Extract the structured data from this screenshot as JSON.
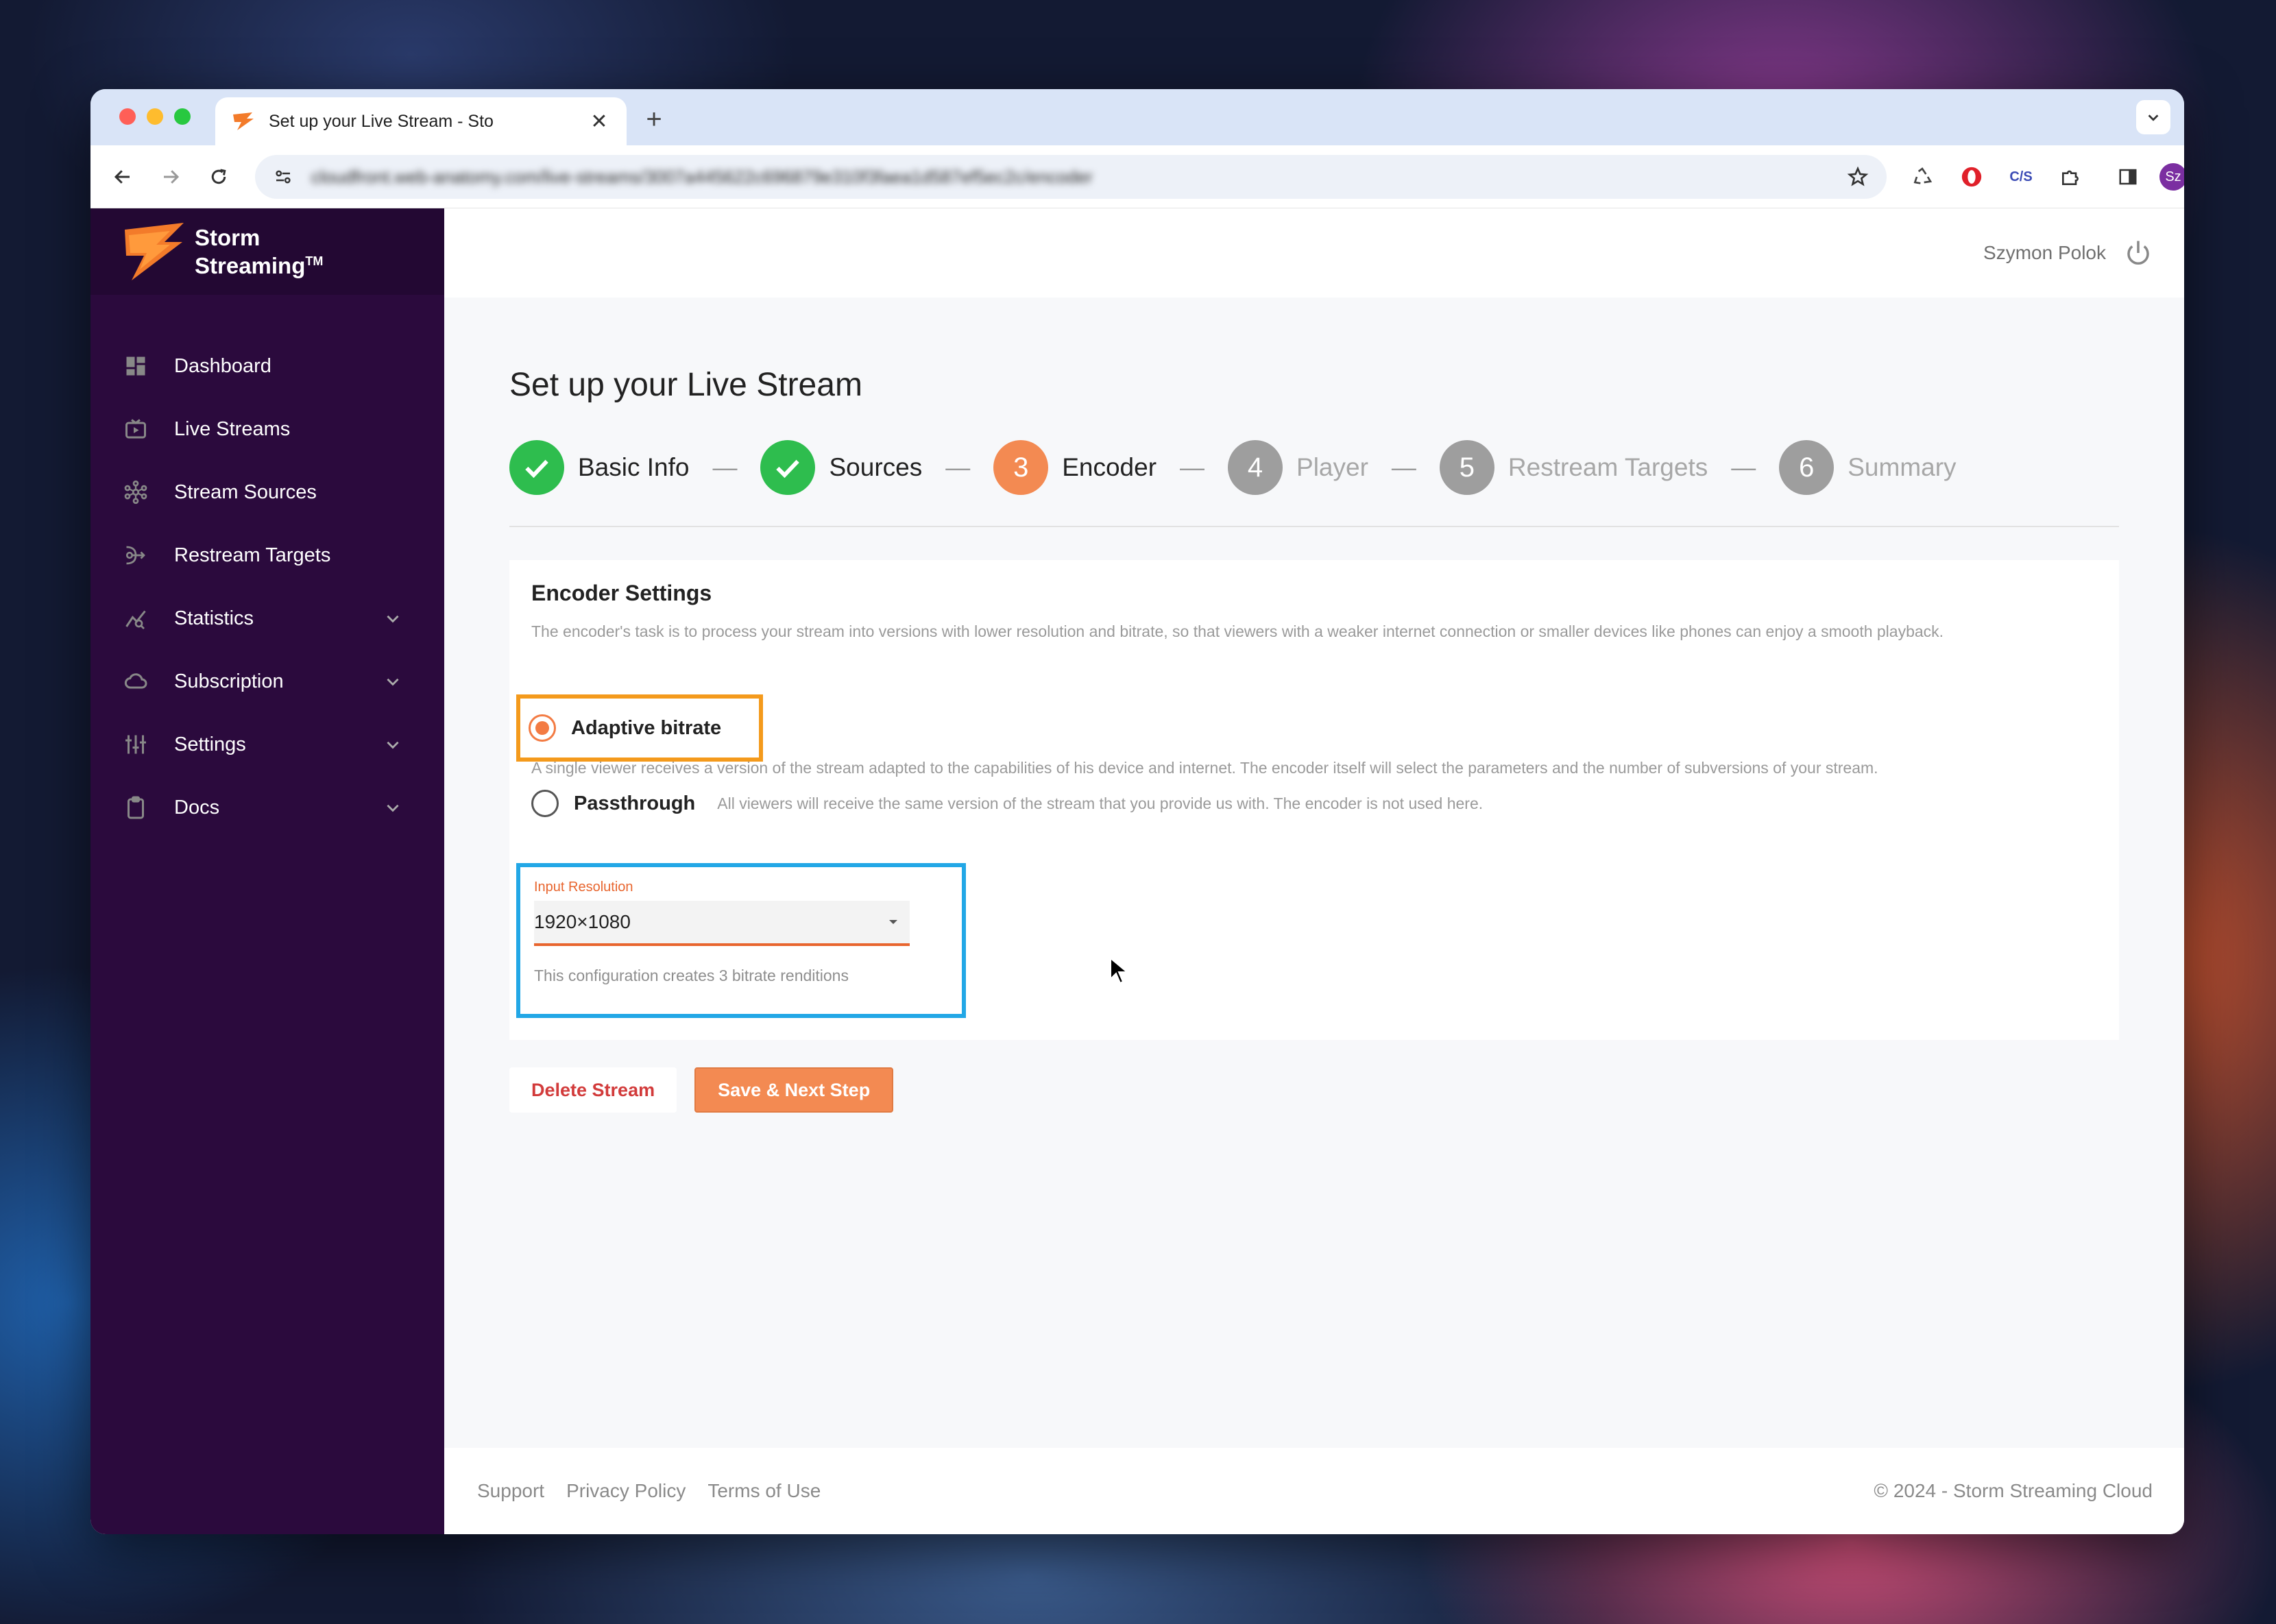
{
  "browser": {
    "tab_title": "Set up your Live Stream - Sto",
    "url": "cloudfront.web-anatomy.com/live-streams/3007a445622c696879e310f3faea1d587ef5ec2c/encoder",
    "new_tab": "+",
    "tab_close": "✕",
    "profile_initials": "Sz",
    "ext_cs_label": "C/S"
  },
  "sidebar": {
    "brand_line1": "Storm",
    "brand_line2": "Streaming",
    "brand_tm": "TM",
    "items": [
      {
        "label": "Dashboard",
        "icon": "dashboard-icon"
      },
      {
        "label": "Live Streams",
        "icon": "live-streams-icon"
      },
      {
        "label": "Stream Sources",
        "icon": "stream-sources-icon"
      },
      {
        "label": "Restream Targets",
        "icon": "restream-targets-icon"
      },
      {
        "label": "Statistics",
        "icon": "statistics-icon",
        "expandable": true
      },
      {
        "label": "Subscription",
        "icon": "cloud-icon",
        "expandable": true
      },
      {
        "label": "Settings",
        "icon": "sliders-icon",
        "expandable": true
      },
      {
        "label": "Docs",
        "icon": "clipboard-icon",
        "expandable": true
      }
    ]
  },
  "header": {
    "user_name": "Szymon Polok"
  },
  "page": {
    "title": "Set up your Live Stream",
    "steps": [
      {
        "number": "1",
        "label": "Basic Info",
        "state": "done"
      },
      {
        "number": "2",
        "label": "Sources",
        "state": "done"
      },
      {
        "number": "3",
        "label": "Encoder",
        "state": "active"
      },
      {
        "number": "4",
        "label": "Player",
        "state": "pending"
      },
      {
        "number": "5",
        "label": "Restream Targets",
        "state": "pending"
      },
      {
        "number": "6",
        "label": "Summary",
        "state": "pending"
      }
    ],
    "step_separator": "—"
  },
  "encoder": {
    "title": "Encoder Settings",
    "description": "The encoder's task is to process your stream into versions with lower resolution and bitrate, so that viewers with a weaker internet connection or smaller devices like phones can enjoy a smooth playback.",
    "options": [
      {
        "label": "Adaptive bitrate",
        "selected": true,
        "description": "A single viewer receives a version of the stream adapted to the capabilities of his device and internet. The encoder itself will select the parameters and the number of subversions of your stream."
      },
      {
        "label": "Passthrough",
        "selected": false,
        "description": "All viewers will receive the same version of the stream that you provide us with. The encoder is not used here."
      }
    ],
    "resolution_label": "Input Resolution",
    "resolution_value": "1920×1080",
    "resolution_hint": "This configuration creates 3 bitrate renditions"
  },
  "actions": {
    "delete_label": "Delete Stream",
    "next_label": "Save & Next Step"
  },
  "footer": {
    "links": [
      "Support",
      "Privacy Policy",
      "Terms of Use"
    ],
    "copyright": "© 2024 - Storm Streaming Cloud"
  },
  "colors": {
    "sidebar_bg": "#2b0a3d",
    "accent": "#f38a52",
    "done_green": "#2ebd4e",
    "highlight_orange": "#f49a1c",
    "highlight_blue": "#22a7e6"
  }
}
